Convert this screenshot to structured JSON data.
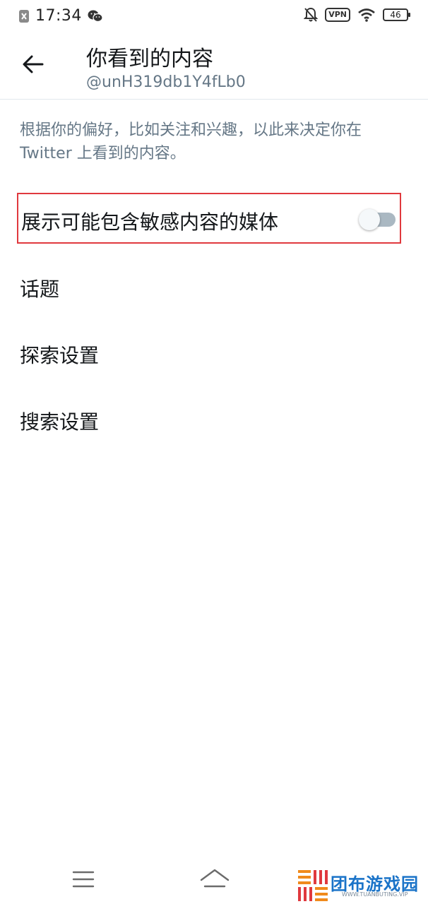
{
  "status_bar": {
    "time": "17:34",
    "vpn_label": "VPN",
    "battery_level": "46",
    "icons": [
      "notification-blocked-icon",
      "wechat-icon",
      "bell-off-icon",
      "wifi-icon",
      "battery-icon"
    ]
  },
  "header": {
    "title": "你看到的内容",
    "subtitle": "@unH319db1Y4fLb0",
    "back_icon": "arrow-left-icon"
  },
  "description": "根据你的偏好，比如关注和兴趣，以此来决定你在 Twitter 上看到的内容。",
  "sensitive_media": {
    "label": "展示可能包含敏感内容的媒体",
    "enabled": false,
    "highlight_color": "#e0393e"
  },
  "menu_items": [
    {
      "label": "话题"
    },
    {
      "label": "探索设置"
    },
    {
      "label": "搜索设置"
    }
  ],
  "nav_bar": {
    "icons": [
      "menu-icon",
      "home-icon"
    ]
  },
  "watermark": {
    "text": "团布游戏园",
    "subtext": "WWW.TUANBUTING.VIP"
  },
  "colors": {
    "primary_text": "#14171a",
    "secondary_text": "#657786",
    "divider": "#e1e8ed",
    "switch_track_off": "#aab8c2",
    "watermark_blue": "#1a73c8"
  }
}
